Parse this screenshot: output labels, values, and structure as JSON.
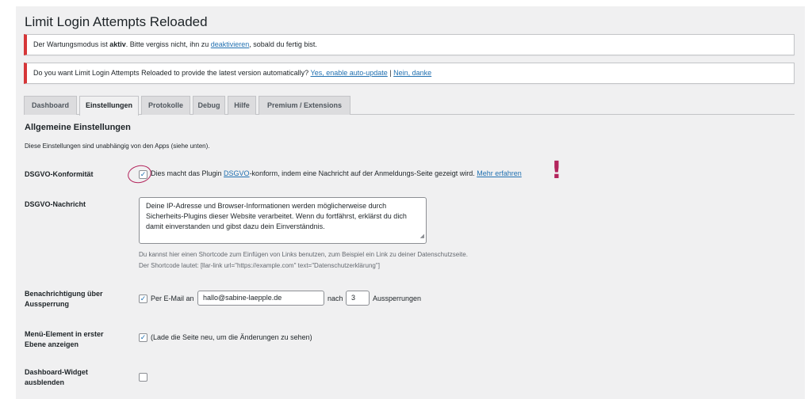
{
  "page": {
    "title": "Limit Login Attempts Reloaded"
  },
  "notices": {
    "maintenance": {
      "prefix": "Der Wartungsmodus ist ",
      "bold": "aktiv",
      "middle": ". Bitte vergiss nicht, ihn zu ",
      "link": "deaktivieren",
      "suffix": ", sobald du fertig bist."
    },
    "autoupdate": {
      "text": "Do you want Limit Login Attempts Reloaded to provide the latest version automatically? ",
      "link_yes": "Yes, enable auto-update",
      "separator": " | ",
      "link_no": "Nein, danke"
    }
  },
  "tabs": [
    {
      "label": "Dashboard",
      "active": false
    },
    {
      "label": "Einstellungen",
      "active": true
    },
    {
      "label": "Protokolle",
      "active": false
    },
    {
      "label": "Debug",
      "active": false
    },
    {
      "label": "Hilfe",
      "active": false
    },
    {
      "label": "Premium / Extensions",
      "active": false
    }
  ],
  "section": {
    "title": "Allgemeine Einstellungen",
    "description": "Diese Einstellungen sind unabhängig von den Apps (siehe unten)."
  },
  "gdpr": {
    "label": "DSGVO-Konformität",
    "checked": true,
    "text_before": "Dies macht das Plugin ",
    "link_dsgvo": "DSGVO",
    "text_after": "-konform, indem eine Nachricht auf der Anmeldungs-Seite gezeigt wird. ",
    "link_more": "Mehr erfahren",
    "highlight_color": "#b3245c",
    "exclamation": "!"
  },
  "gdpr_message": {
    "label": "DSGVO-Nachricht",
    "value": "Deine IP-Adresse und Browser-Informationen werden möglicherweise durch Sicherheits-Plugins dieser Website verarbeitet. Wenn du fortfährst, erklärst du dich damit einverstanden und gibst dazu dein Einverständnis.",
    "hint_line1": "Du kannst hier einen Shortcode zum Einfügen von Links benutzen, zum Beispiel ein Link zu deiner Datenschutzseite.",
    "hint_line2": "Der Shortcode lautet: [llar-link url=\"https://example.com\" text=\"Datenschutzerklärung\"]"
  },
  "lockout_notify": {
    "label": "Benachrichtigung über Aussperrung",
    "checked": true,
    "text_email": "Per E-Mail an",
    "email": "hallo@sabine-laepple.de",
    "text_after": "nach",
    "count": "3",
    "text_unit": "Aussperrungen"
  },
  "menu_top": {
    "label": "Menü-Element in erster Ebene anzeigen",
    "checked": true,
    "text": "(Lade die Seite neu, um die Änderungen zu sehen)"
  },
  "dashboard_widget": {
    "label": "Dashboard-Widget ausblenden",
    "checked": false
  },
  "colors": {
    "accent": "#2271b1",
    "error": "#d63638",
    "background": "#f0f0f1"
  }
}
